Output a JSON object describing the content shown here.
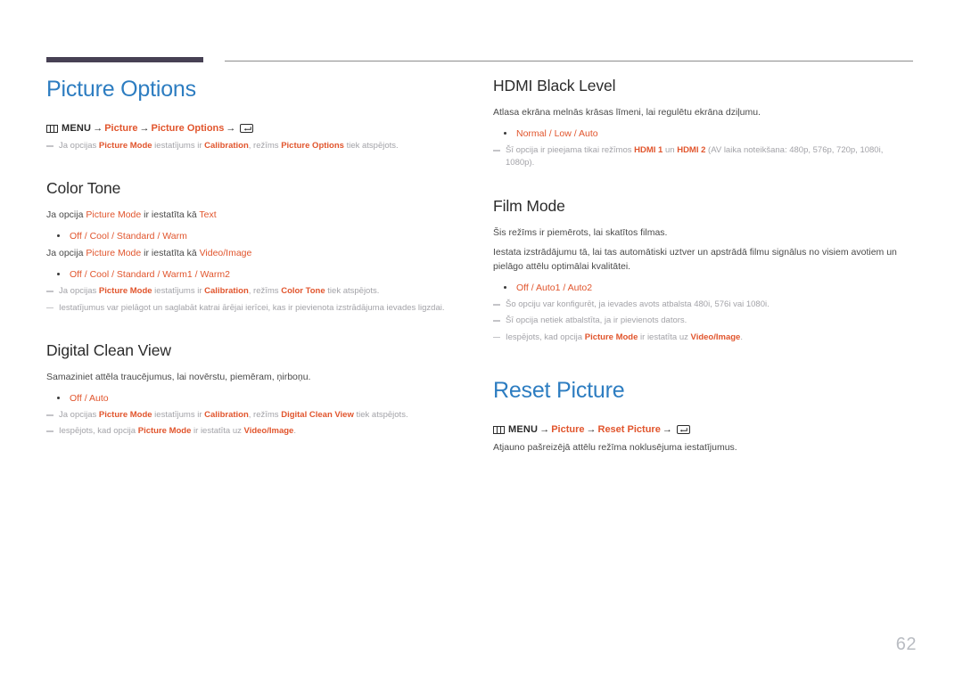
{
  "page": {
    "number": "62",
    "accent_blue": "#2d7dc1",
    "accent_orange": "#e1552d",
    "rule_color": "#474154",
    "note_color": "#a3a3a8"
  },
  "icons": {
    "menu": "menu-icon",
    "enter": "enter-key-icon",
    "arrow": "→"
  },
  "left": {
    "title": "Picture Options",
    "menupath": {
      "menu_label": "MENU",
      "crumb1": "Picture",
      "crumb2": "Picture Options"
    },
    "title_note": {
      "p1": "Ja opcijas ",
      "b1": "Picture Mode",
      "p2": " iestatījums ir ",
      "b2": "Calibration",
      "p3": ", režīms ",
      "b3": "Picture Options",
      "p4": " tiek atspējots."
    },
    "color_tone": {
      "heading": "Color Tone",
      "line1": {
        "p1": "Ja opcija ",
        "h1": "Picture Mode",
        "p2": " ir iestatīta kā ",
        "h2": "Text"
      },
      "options1": "Off / Cool / Standard / Warm",
      "line2": {
        "p1": "Ja opcija ",
        "h1": "Picture Mode",
        "p2": " ir iestatīta kā ",
        "h2": "Video/Image"
      },
      "options2": "Off / Cool / Standard / Warm1 / Warm2",
      "note1": {
        "p1": "Ja opcijas ",
        "b1": "Picture Mode",
        "p2": " iestatījums ir ",
        "b2": "Calibration",
        "p3": ", režīms ",
        "b3": "Color Tone",
        "p4": " tiek atspējots."
      },
      "note2": "Iestatījumus var pielāgot un saglabāt katrai ārējai ierīcei, kas ir pievienota izstrādājuma ievades ligzdai."
    },
    "digital_clean_view": {
      "heading": "Digital Clean View",
      "desc": "Samaziniet attēla traucējumus, lai novērstu, piemēram, ņirboņu.",
      "options": "Off / Auto",
      "note1": {
        "p1": "Ja opcijas ",
        "b1": "Picture Mode",
        "p2": " iestatījums ir ",
        "b2": "Calibration",
        "p3": ", režīms ",
        "b3": "Digital Clean View",
        "p4": " tiek atspējots."
      },
      "note2": {
        "p1": "Iespējots, kad opcija ",
        "b1": "Picture Mode",
        "p2": " ir iestatīta uz ",
        "b2": "Video/Image",
        "p3": "."
      }
    }
  },
  "right": {
    "hdmi_black_level": {
      "heading": "HDMI Black Level",
      "desc": "Atlasa ekrāna melnās krāsas līmeni, lai regulētu ekrāna dziļumu.",
      "options": "Normal / Low / Auto",
      "note1": {
        "p1": "Šī opcija ir pieejama tikai režīmos ",
        "b1": "HDMI 1",
        "p2": " un ",
        "b2": "HDMI 2",
        "p3": " (AV laika noteikšana: 480p, 576p, 720p, 1080i, 1080p)."
      }
    },
    "film_mode": {
      "heading": "Film Mode",
      "desc1": "Šis režīms ir piemērots, lai skatītos filmas.",
      "desc2": "Iestata izstrādājumu tā, lai tas automātiski uztver un apstrādā filmu signālus no visiem avotiem un pielāgo attēlu optimālai kvalitātei.",
      "options": "Off / Auto1 / Auto2",
      "note1": "Šo opciju var konfigurēt, ja ievades avots atbalsta 480i, 576i vai 1080i.",
      "note2": "Šī opcija netiek atbalstīta, ja ir pievienots dators.",
      "note3": {
        "p1": "Iespējots, kad opcija ",
        "b1": "Picture Mode",
        "p2": " ir iestatīta uz ",
        "b2": "Video/Image",
        "p3": "."
      }
    },
    "reset_picture": {
      "title": "Reset Picture",
      "menupath": {
        "menu_label": "MENU",
        "crumb1": "Picture",
        "crumb2": "Reset Picture"
      },
      "desc": "Atjauno pašreizējā attēlu režīma noklusējuma iestatījumus."
    }
  }
}
